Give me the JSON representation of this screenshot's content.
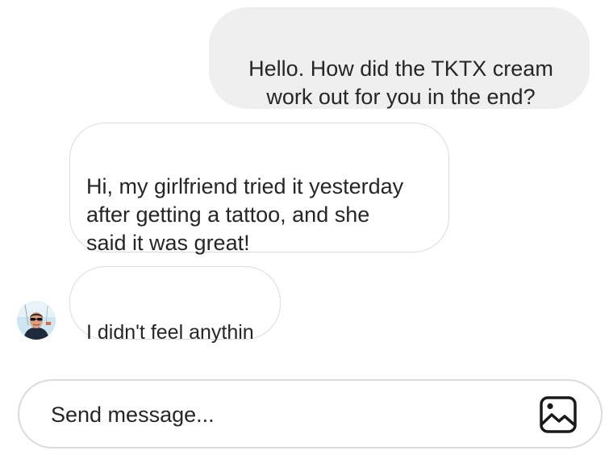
{
  "messages": [
    {
      "direction": "outgoing",
      "text": "Hello. How did the TKTX cream\nwork out for you in the end?"
    },
    {
      "direction": "incoming",
      "text": "Hi, my girlfriend tried it yesterday\nafter getting a tattoo, and she\nsaid it was great!"
    },
    {
      "direction": "incoming",
      "text": "I didn't feel anythin"
    }
  ],
  "composer": {
    "placeholder": "Send message...",
    "image_icon": "image-icon"
  },
  "colors": {
    "outgoing_bubble": "#efefef",
    "incoming_border": "#dbdbdb",
    "text": "#262626"
  }
}
